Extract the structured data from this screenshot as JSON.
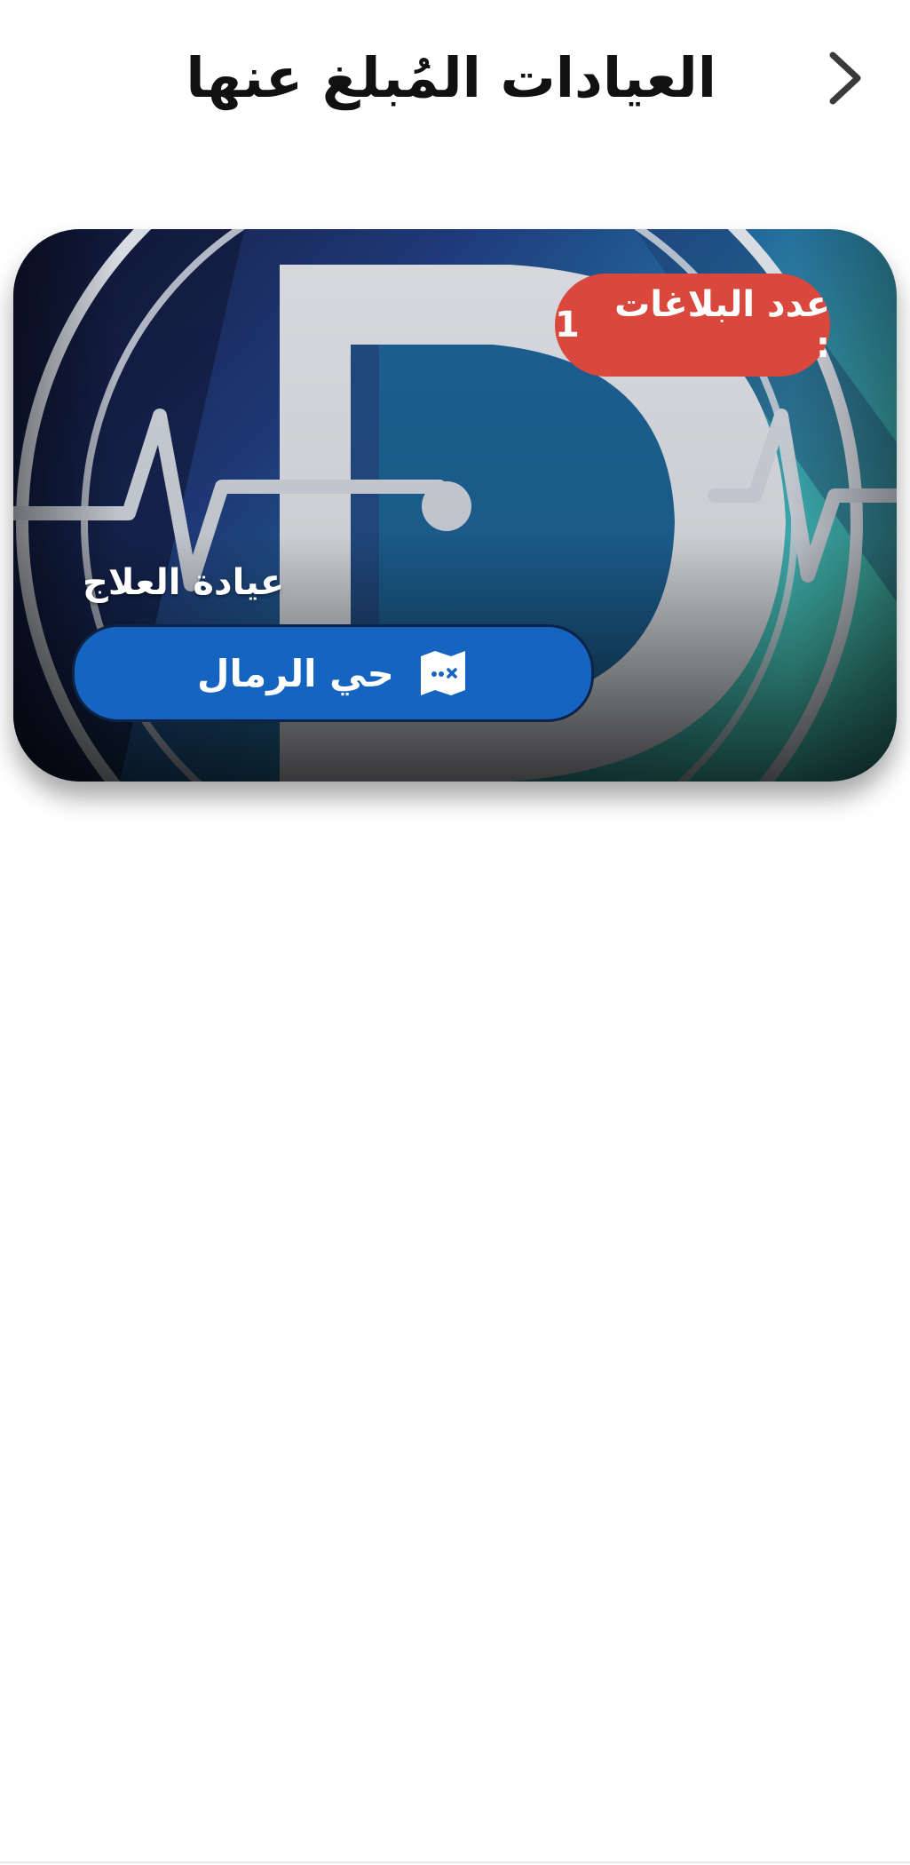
{
  "header": {
    "title": "العيادات المُبلغ عنها",
    "back_icon": "chevron-right-icon"
  },
  "clinic_card": {
    "name": "عيادة العلاج",
    "reports_label": "عدد البلاغات :",
    "reports_count": "1",
    "location": "حي الرمال",
    "location_icon": "map-icon",
    "colors": {
      "badge": "#d9473d",
      "location_pill": "#1565c0",
      "logo_teal": "#3fb9b1",
      "logo_navy": "#1b2557"
    }
  }
}
